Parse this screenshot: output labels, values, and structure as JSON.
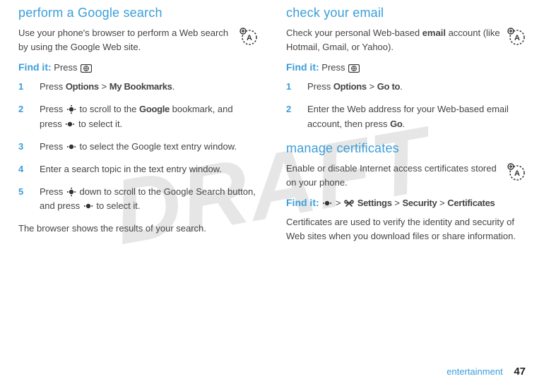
{
  "watermark": "DRAFT",
  "left": {
    "heading": "perform a Google search",
    "intro": "Use your phone's browser to perform a Web search by using the Google Web site.",
    "findit_label": "Find it:",
    "findit_text": "Press ",
    "steps": {
      "s1_pre": "Press ",
      "s1_b1": "Options",
      "s1_mid": " > ",
      "s1_b2": "My Bookmarks",
      "s1_post": ".",
      "s2_pre": "Press ",
      "s2_mid1": " to scroll to the ",
      "s2_b1": "Google",
      "s2_mid2": " bookmark, and press ",
      "s2_post": " to select it.",
      "s3_pre": "Press ",
      "s3_post": " to select the Google text entry window.",
      "s4": "Enter a search topic in the text entry window.",
      "s5_pre": "Press ",
      "s5_mid": " down to scroll to the Google Search button, and press ",
      "s5_post": " to select it."
    },
    "outro": "The browser shows the results of your search."
  },
  "right": {
    "heading1": "check your email",
    "intro_pre": "Check your personal Web-based ",
    "intro_bold": "email",
    "intro_post": " account (like Hotmail, Gmail, or Yahoo).",
    "findit_label": "Find it:",
    "findit_text": "Press ",
    "steps1": {
      "s1_pre": "Press ",
      "s1_b1": "Options",
      "s1_mid": " > ",
      "s1_b2": "Go to",
      "s1_post": ".",
      "s2_pre": "Enter the Web address for your Web-based email account, then press ",
      "s2_b1": "Go",
      "s2_post": "."
    },
    "heading2": "manage certificates",
    "intro2": "Enable or disable Internet access certificates stored on your phone.",
    "findit2_label": "Find it:",
    "findit2_sep1": " > ",
    "findit2_b1": "Settings",
    "findit2_sep2": " > ",
    "findit2_b2": "Security",
    "findit2_sep3": " > ",
    "findit2_b3": "Certificates",
    "outro2": "Certificates are used to verify the identity and security of Web sites when you download files or share information."
  },
  "nums": {
    "n1": "1",
    "n2": "2",
    "n3": "3",
    "n4": "4",
    "n5": "5"
  },
  "footer": {
    "label": "entertainment",
    "page": "47"
  }
}
